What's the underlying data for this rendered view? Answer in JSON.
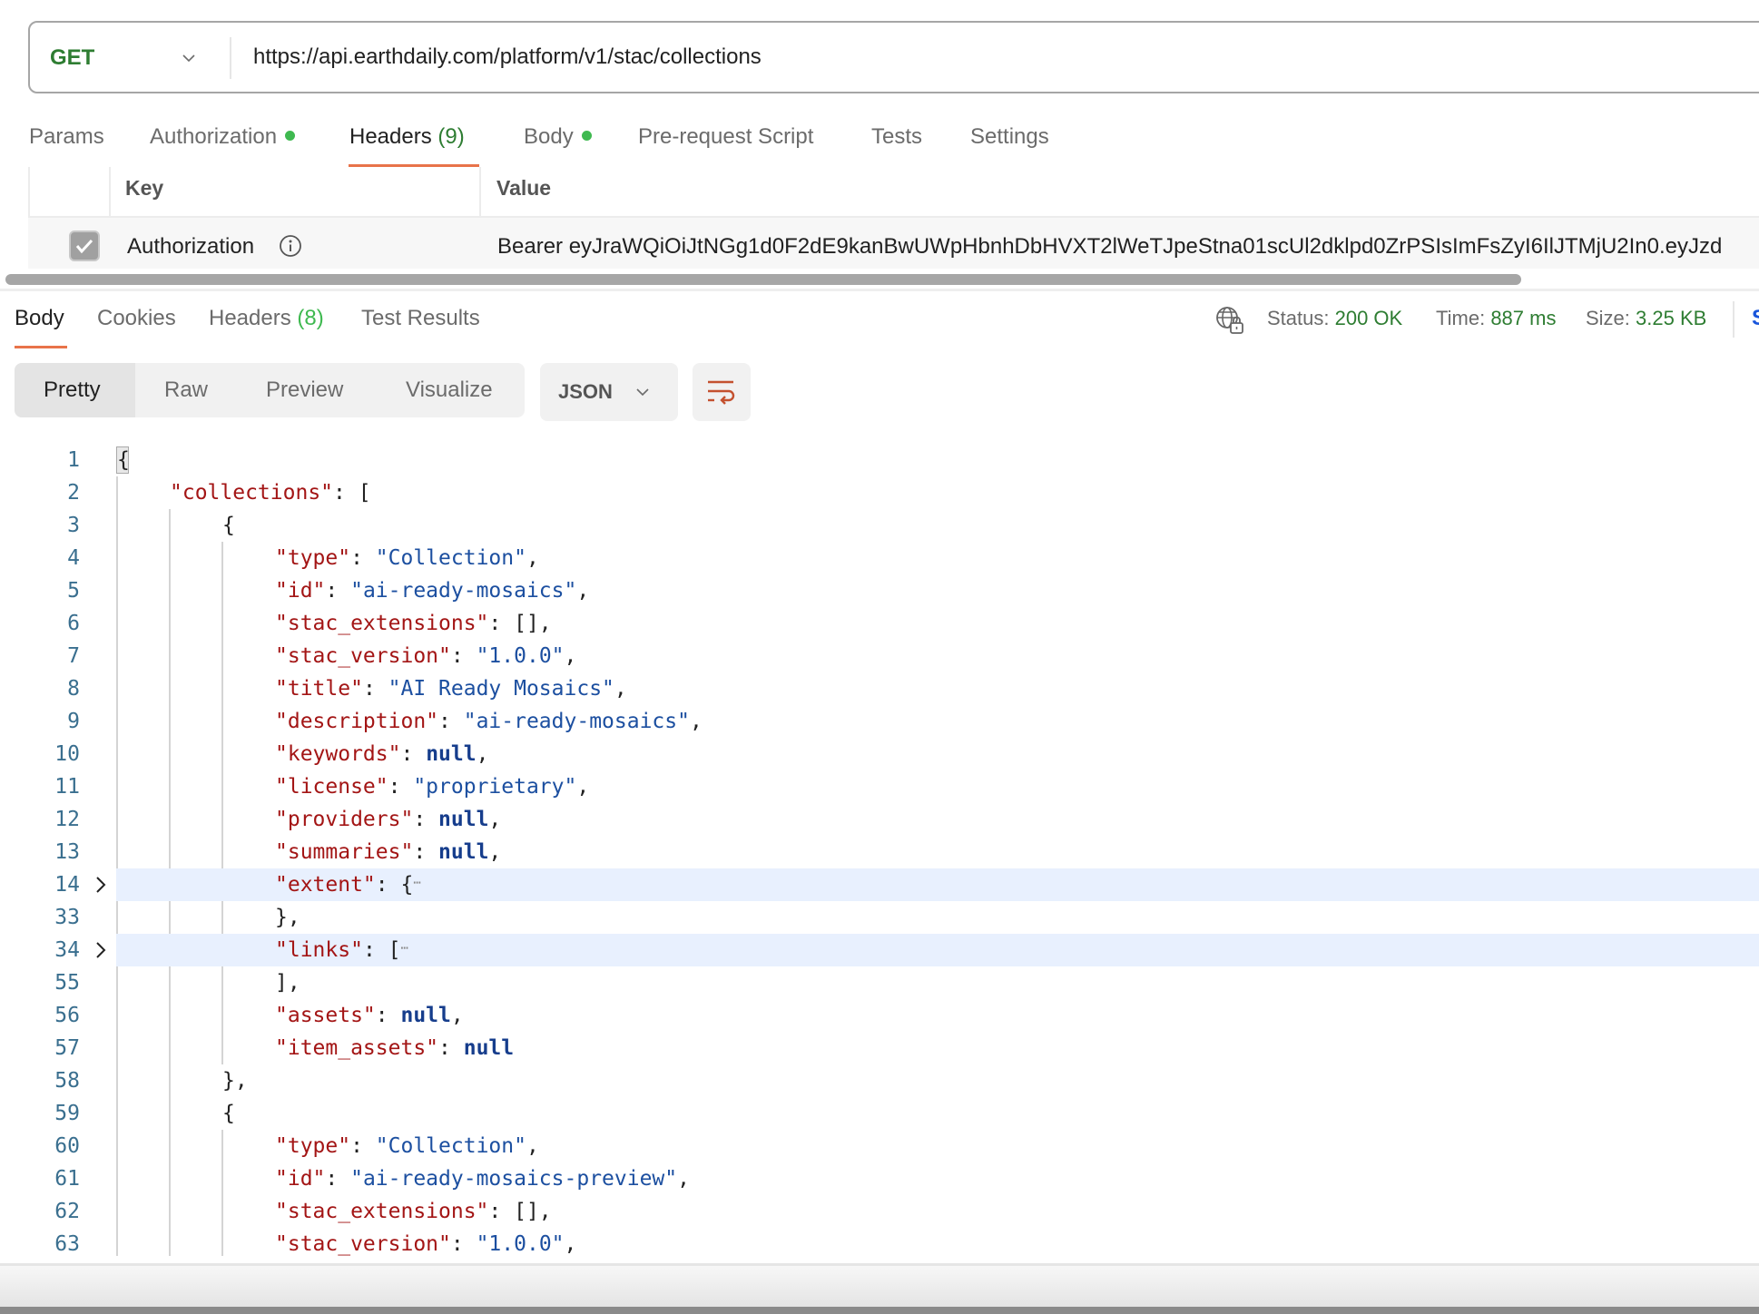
{
  "request": {
    "method": "GET",
    "url": "https://api.earthdaily.com/platform/v1/stac/collections",
    "tabs": [
      {
        "label": "Params"
      },
      {
        "label": "Authorization",
        "dot": true
      },
      {
        "label": "Headers",
        "count": "(9)",
        "active": true
      },
      {
        "label": "Body",
        "dot": true
      },
      {
        "label": "Pre-request Script"
      },
      {
        "label": "Tests"
      },
      {
        "label": "Settings"
      }
    ],
    "headers_table": {
      "columns": [
        "Key",
        "Value"
      ],
      "rows": [
        {
          "checked": true,
          "key": "Authorization",
          "value": "Bearer eyJraWQiOiJtNGg1d0F2dE9kanBwUWpHbnhDbHVXT2lWeTJpeStna01scUl2dklpd0ZrPSIsImFsZyI6IlJTMjU2In0.eyJzd"
        }
      ]
    }
  },
  "response": {
    "tabs": [
      {
        "label": "Body",
        "active": true
      },
      {
        "label": "Cookies"
      },
      {
        "label": "Headers",
        "count": "(8)"
      },
      {
        "label": "Test Results"
      }
    ],
    "status_label": "Status:",
    "status_value": "200 OK",
    "time_label": "Time:",
    "time_value": "887 ms",
    "size_label": "Size:",
    "size_value": "3.25 KB",
    "save_partial": "S",
    "view_modes": [
      "Pretty",
      "Raw",
      "Preview",
      "Visualize"
    ],
    "active_view": "Pretty",
    "format": "JSON",
    "colors": {
      "accent": "#e8734a",
      "success": "#2e7d32",
      "key": "#a31515",
      "string": "#1c4fa0"
    }
  },
  "code_lines": [
    {
      "n": "1",
      "indent": 0,
      "parts": [
        [
          "p",
          "{"
        ]
      ]
    },
    {
      "n": "2",
      "indent": 1,
      "parts": [
        [
          "k",
          "\"collections\""
        ],
        [
          "p",
          ": ["
        ]
      ]
    },
    {
      "n": "3",
      "indent": 2,
      "parts": [
        [
          "p",
          "{"
        ]
      ]
    },
    {
      "n": "4",
      "indent": 3,
      "parts": [
        [
          "k",
          "\"type\""
        ],
        [
          "p",
          ": "
        ],
        [
          "s",
          "\"Collection\""
        ],
        [
          "p",
          ","
        ]
      ]
    },
    {
      "n": "5",
      "indent": 3,
      "parts": [
        [
          "k",
          "\"id\""
        ],
        [
          "p",
          ": "
        ],
        [
          "s",
          "\"ai-ready-mosaics\""
        ],
        [
          "p",
          ","
        ]
      ]
    },
    {
      "n": "6",
      "indent": 3,
      "parts": [
        [
          "k",
          "\"stac_extensions\""
        ],
        [
          "p",
          ": [],"
        ]
      ]
    },
    {
      "n": "7",
      "indent": 3,
      "parts": [
        [
          "k",
          "\"stac_version\""
        ],
        [
          "p",
          ": "
        ],
        [
          "s",
          "\"1.0.0\""
        ],
        [
          "p",
          ","
        ]
      ]
    },
    {
      "n": "8",
      "indent": 3,
      "parts": [
        [
          "k",
          "\"title\""
        ],
        [
          "p",
          ": "
        ],
        [
          "s",
          "\"AI Ready Mosaics\""
        ],
        [
          "p",
          ","
        ]
      ]
    },
    {
      "n": "9",
      "indent": 3,
      "parts": [
        [
          "k",
          "\"description\""
        ],
        [
          "p",
          ": "
        ],
        [
          "s",
          "\"ai-ready-mosaics\""
        ],
        [
          "p",
          ","
        ]
      ]
    },
    {
      "n": "10",
      "indent": 3,
      "parts": [
        [
          "k",
          "\"keywords\""
        ],
        [
          "p",
          ": "
        ],
        [
          "n",
          "null"
        ],
        [
          "p",
          ","
        ]
      ]
    },
    {
      "n": "11",
      "indent": 3,
      "parts": [
        [
          "k",
          "\"license\""
        ],
        [
          "p",
          ": "
        ],
        [
          "s",
          "\"proprietary\""
        ],
        [
          "p",
          ","
        ]
      ]
    },
    {
      "n": "12",
      "indent": 3,
      "parts": [
        [
          "k",
          "\"providers\""
        ],
        [
          "p",
          ": "
        ],
        [
          "n",
          "null"
        ],
        [
          "p",
          ","
        ]
      ]
    },
    {
      "n": "13",
      "indent": 3,
      "parts": [
        [
          "k",
          "\"summaries\""
        ],
        [
          "p",
          ": "
        ],
        [
          "n",
          "null"
        ],
        [
          "p",
          ","
        ]
      ]
    },
    {
      "n": "14",
      "indent": 3,
      "folded": true,
      "parts": [
        [
          "k",
          "\"extent\""
        ],
        [
          "p",
          ": {"
        ],
        [
          "e",
          "⋯"
        ]
      ]
    },
    {
      "n": "33",
      "indent": 3,
      "parts": [
        [
          "p",
          "},"
        ]
      ]
    },
    {
      "n": "34",
      "indent": 3,
      "folded": true,
      "parts": [
        [
          "k",
          "\"links\""
        ],
        [
          "p",
          ": ["
        ],
        [
          "e",
          "⋯"
        ]
      ]
    },
    {
      "n": "55",
      "indent": 3,
      "parts": [
        [
          "p",
          "],"
        ]
      ]
    },
    {
      "n": "56",
      "indent": 3,
      "parts": [
        [
          "k",
          "\"assets\""
        ],
        [
          "p",
          ": "
        ],
        [
          "n",
          "null"
        ],
        [
          "p",
          ","
        ]
      ]
    },
    {
      "n": "57",
      "indent": 3,
      "parts": [
        [
          "k",
          "\"item_assets\""
        ],
        [
          "p",
          ": "
        ],
        [
          "n",
          "null"
        ]
      ]
    },
    {
      "n": "58",
      "indent": 2,
      "parts": [
        [
          "p",
          "},"
        ]
      ]
    },
    {
      "n": "59",
      "indent": 2,
      "parts": [
        [
          "p",
          "{"
        ]
      ]
    },
    {
      "n": "60",
      "indent": 3,
      "parts": [
        [
          "k",
          "\"type\""
        ],
        [
          "p",
          ": "
        ],
        [
          "s",
          "\"Collection\""
        ],
        [
          "p",
          ","
        ]
      ]
    },
    {
      "n": "61",
      "indent": 3,
      "parts": [
        [
          "k",
          "\"id\""
        ],
        [
          "p",
          ": "
        ],
        [
          "s",
          "\"ai-ready-mosaics-preview\""
        ],
        [
          "p",
          ","
        ]
      ]
    },
    {
      "n": "62",
      "indent": 3,
      "parts": [
        [
          "k",
          "\"stac_extensions\""
        ],
        [
          "p",
          ": [],"
        ]
      ]
    },
    {
      "n": "63",
      "indent": 3,
      "parts": [
        [
          "k",
          "\"stac_version\""
        ],
        [
          "p",
          ": "
        ],
        [
          "s",
          "\"1.0.0\""
        ],
        [
          "p",
          ","
        ]
      ]
    }
  ]
}
